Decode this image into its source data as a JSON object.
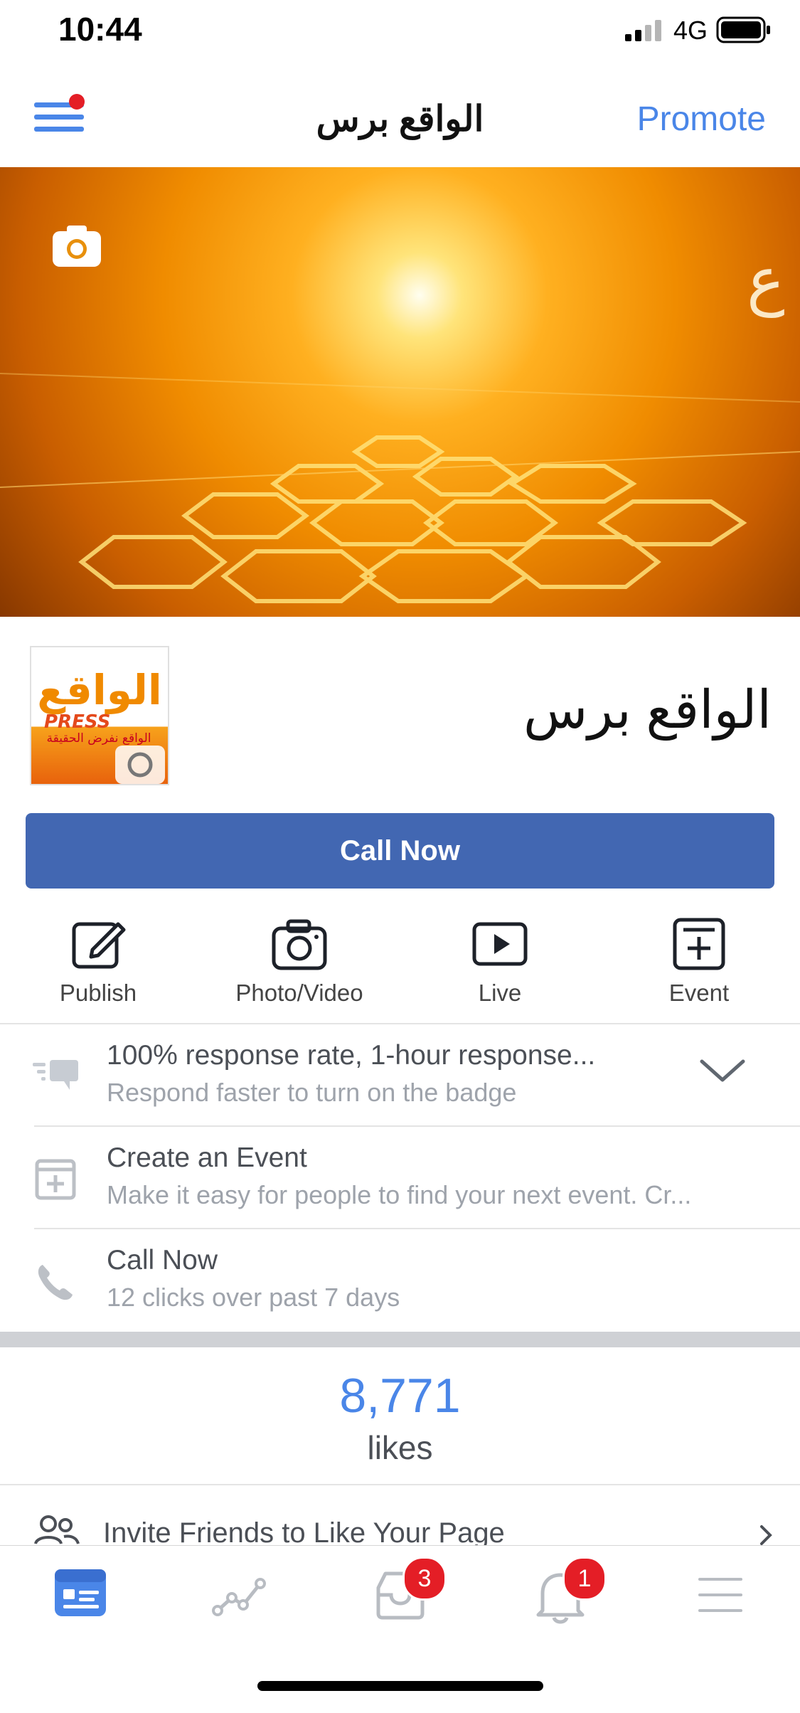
{
  "status_bar": {
    "time": "10:44",
    "network": "4G"
  },
  "nav": {
    "title": "الواقع برس",
    "promote_label": "Promote"
  },
  "cover": {
    "camera_icon": "camera-icon"
  },
  "profile": {
    "page_name": "الواقع برس",
    "logo_text": "الواقع",
    "logo_sub": "PRESS",
    "logo_tagline": "الواقع نفرض الحقيقة"
  },
  "call_now_button": "Call Now",
  "actions": [
    {
      "label": "Publish",
      "icon": "edit-icon"
    },
    {
      "label": "Photo/Video",
      "icon": "camera-icon"
    },
    {
      "label": "Live",
      "icon": "play-icon"
    },
    {
      "label": "Event",
      "icon": "add-event-icon"
    }
  ],
  "rows": [
    {
      "title": "100% response rate, 1-hour response...",
      "subtitle": "Respond faster to turn on the badge",
      "icon": "chat-icon"
    },
    {
      "title": "Create an Event",
      "subtitle": "Make it easy for people to find your next event. Cr...",
      "icon": "calendar-add-icon"
    },
    {
      "title": "Call Now",
      "subtitle": "12 clicks over past 7 days",
      "icon": "phone-icon"
    }
  ],
  "likes": {
    "count": "8,771",
    "label": "likes"
  },
  "invite": {
    "label": "Invite Friends to Like Your Page"
  },
  "tabbar": {
    "items": [
      {
        "name": "page",
        "icon": "page-icon",
        "active": true
      },
      {
        "name": "insights",
        "icon": "insights-icon"
      },
      {
        "name": "inbox",
        "icon": "inbox-icon",
        "badge": "3"
      },
      {
        "name": "notifications",
        "icon": "bell-icon",
        "badge": "1"
      },
      {
        "name": "menu",
        "icon": "menu-icon"
      }
    ]
  },
  "colors": {
    "accent": "#4a86e8",
    "button": "#4267b2",
    "badge": "#e41e26"
  }
}
